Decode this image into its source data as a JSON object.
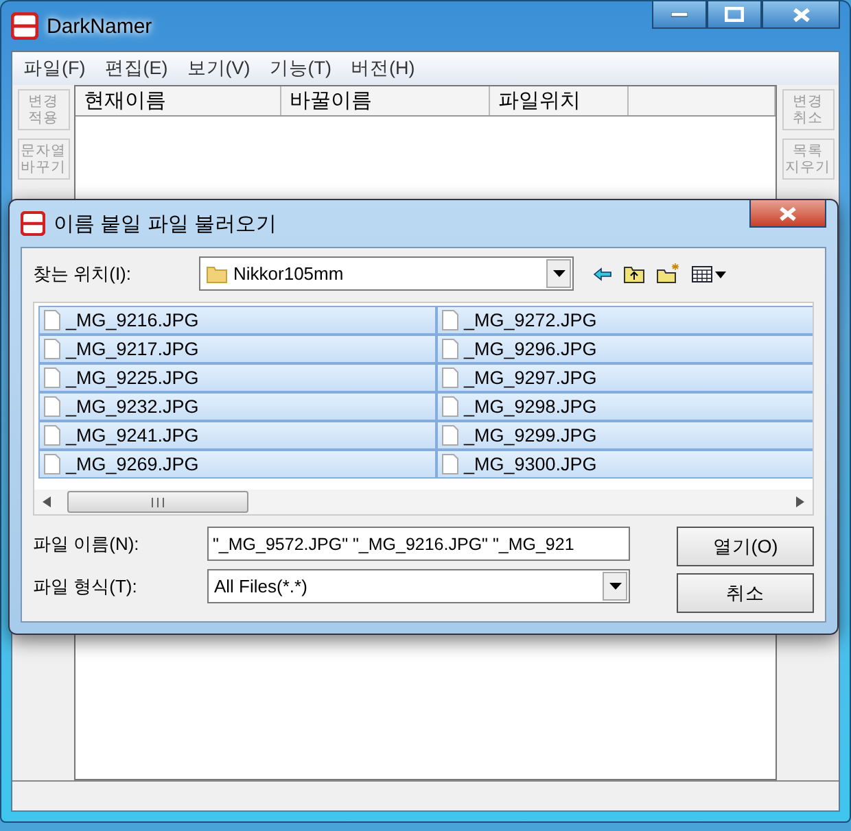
{
  "main_window": {
    "title": "DarkNamer",
    "menu": [
      "파일(F)",
      "편집(E)",
      "보기(V)",
      "기능(T)",
      "버전(H)"
    ],
    "left_buttons": [
      {
        "lines": [
          "변경",
          "적용"
        ],
        "disabled": true
      },
      {
        "lines": [
          "문자열",
          "바꾸기"
        ],
        "disabled": true
      }
    ],
    "right_buttons": [
      {
        "lines": [
          "변경",
          "취소"
        ],
        "disabled": true
      },
      {
        "lines": [
          "목록",
          "지우기"
        ],
        "disabled": true
      }
    ],
    "list_columns": [
      "현재이름",
      "바꿀이름",
      "파일위치"
    ]
  },
  "dialog": {
    "title": "이름 붙일 파일 불러오기",
    "look_in_label": "찾는 위치(I):",
    "look_in": "Nikkor105mm",
    "files": [
      {
        "name": "_MG_9216.JPG",
        "selected": true
      },
      {
        "name": "_MG_9217.JPG",
        "selected": true
      },
      {
        "name": "_MG_9225.JPG",
        "selected": true
      },
      {
        "name": "_MG_9232.JPG",
        "selected": true
      },
      {
        "name": "_MG_9241.JPG",
        "selected": true
      },
      {
        "name": "_MG_9269.JPG",
        "selected": true
      },
      {
        "name": "_MG_9272.JPG",
        "selected": true
      },
      {
        "name": "_MG_9296.JPG",
        "selected": true
      },
      {
        "name": "_MG_9297.JPG",
        "selected": true
      },
      {
        "name": "_MG_9298.JPG",
        "selected": true
      },
      {
        "name": "_MG_9299.JPG",
        "selected": true
      },
      {
        "name": "_MG_9300.JPG",
        "selected": true
      }
    ],
    "filename_label": "파일 이름(N):",
    "filename_value": "\"_MG_9572.JPG\" \"_MG_9216.JPG\" \"_MG_921",
    "filetype_label": "파일 형식(T):",
    "filetype_value": "All Files(*.*)",
    "buttons": [
      "열기(O)",
      "취소"
    ]
  }
}
